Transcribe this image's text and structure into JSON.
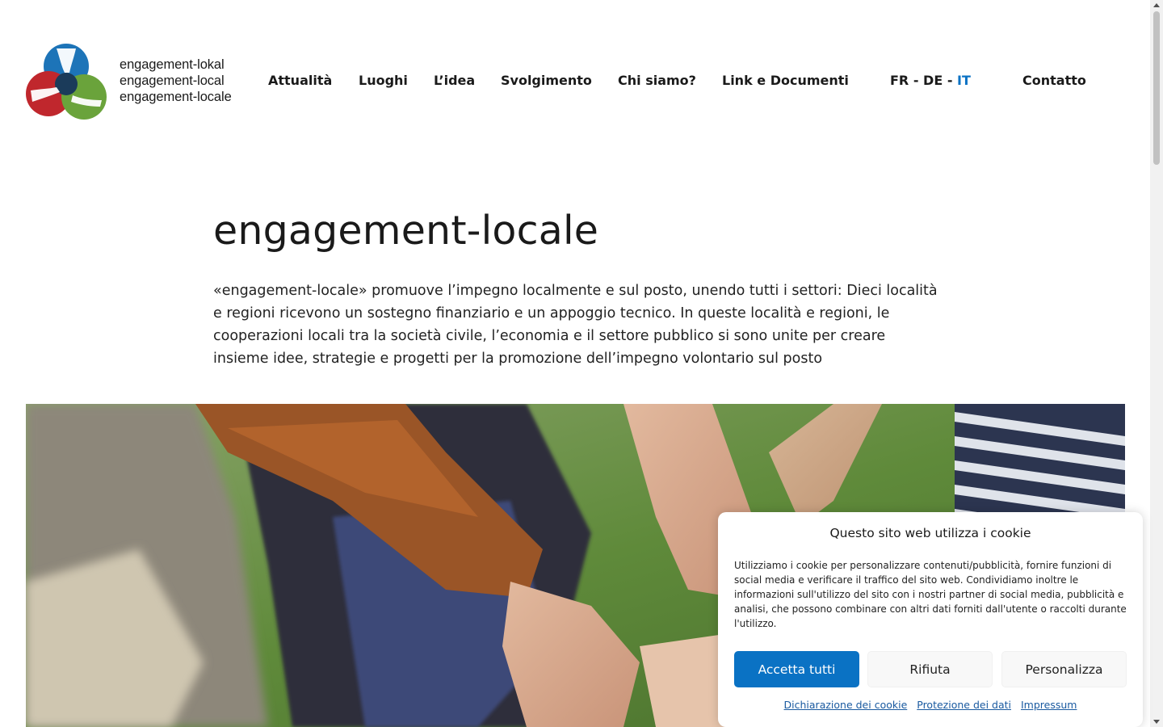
{
  "logo": {
    "lines": [
      "engagement-lokal",
      "engagement-local",
      "engagement-locale"
    ],
    "colors": {
      "blue": "#1d74b8",
      "red": "#c0272d",
      "green": "#6aa33b",
      "dark": "#1b3b5a"
    }
  },
  "nav": {
    "items": [
      "Attualità",
      "Luoghi",
      "L’idea",
      "Svolgimento",
      "Chi siamo?",
      "Link e Documenti"
    ],
    "lang": {
      "fr": "FR",
      "de": "DE",
      "it": "IT",
      "sep": " - "
    },
    "contact": "Contatto"
  },
  "main": {
    "title": "engagement-locale",
    "intro": "«engagement-locale» promuove l’impegno localmente e sul posto, unendo tutti i settori: Dieci località e regioni ricevono un sostegno finanziario e un appoggio tecnico. In queste località e regioni, le cooperazioni locali tra la società civile, l’economia e il settore pubblico si sono unite per creare insieme idee, strategie e progetti per la promozione dell’impegno volontario sul posto"
  },
  "cookie": {
    "title": "Questo sito web utilizza i cookie",
    "text": "Utilizziamo i cookie per personalizzare contenuti/pubblicità, fornire funzioni di social media e verificare il traffico del sito web. Condividiamo inoltre le informazioni sull'utilizzo del sito con i nostri partner di social media, pubblicità e analisi, che possono combinare con altri dati forniti dall'utente o raccolti durante l'utilizzo.",
    "accept": "Accetta tutti",
    "deny": "Rifiuta",
    "customize": "Personalizza",
    "links": [
      "Dichiarazione dei cookie",
      "Protezione dei dati",
      "Impressum"
    ]
  },
  "colors": {
    "accent": "#0a72c4",
    "link": "#1a5aa0"
  }
}
